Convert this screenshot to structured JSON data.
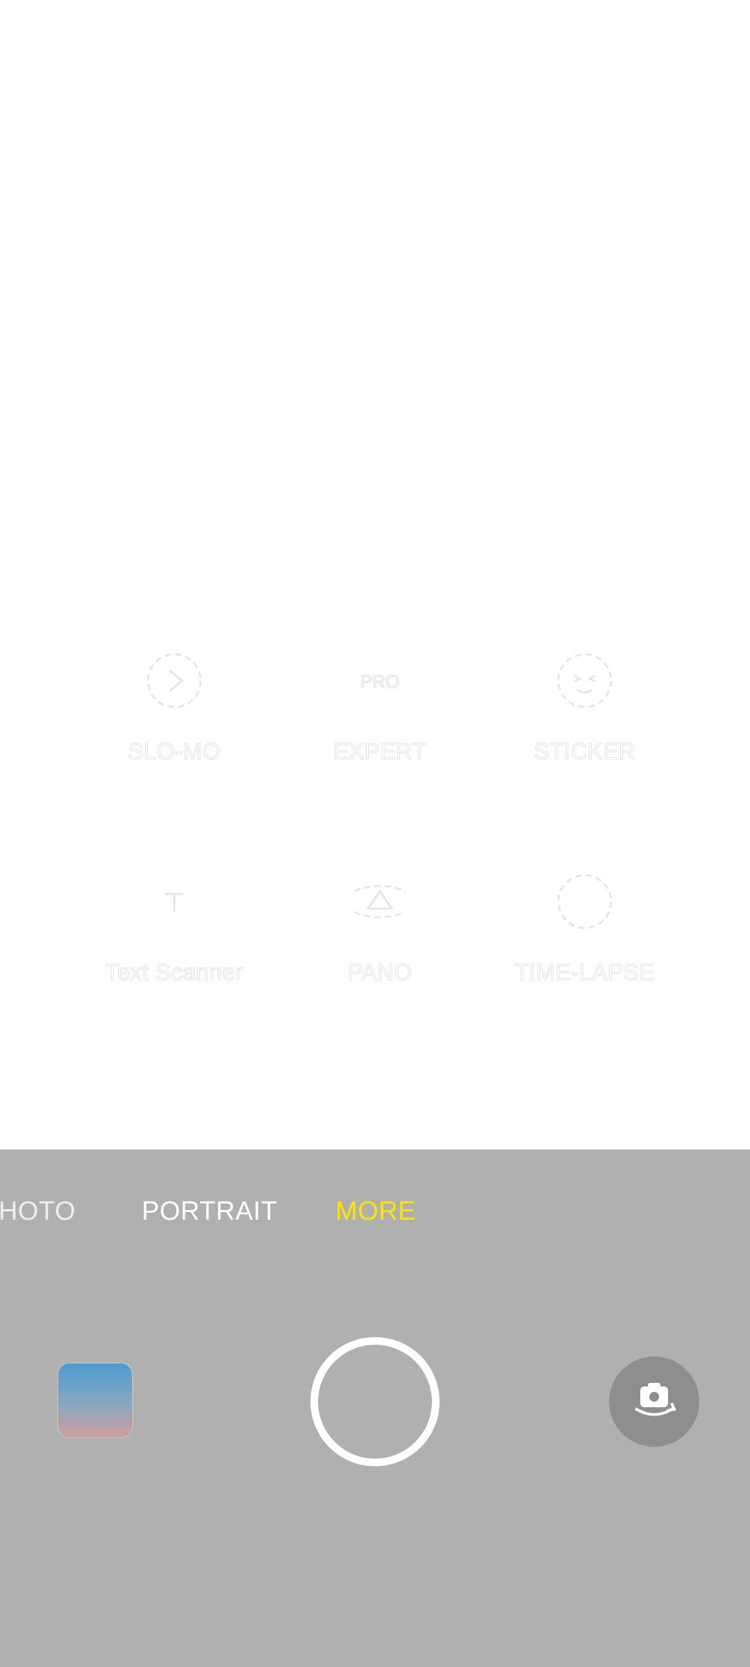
{
  "modes": [
    {
      "id": "slo-mo",
      "label": "SLO-MO",
      "icon": "slow-motion-icon"
    },
    {
      "id": "expert",
      "label": "EXPERT",
      "icon": "expert-icon"
    },
    {
      "id": "sticker",
      "label": "STICKER",
      "icon": "sticker-icon"
    },
    {
      "id": "text-scanner",
      "label": "Text Scanner",
      "icon": "text-scanner-icon"
    },
    {
      "id": "pano",
      "label": "PANO",
      "icon": "pano-icon"
    },
    {
      "id": "time-lapse",
      "label": "TIME-LAPSE",
      "icon": "time-lapse-icon"
    }
  ],
  "tabs": {
    "photo": "PHOTO",
    "portrait": "PORTRAIT",
    "more": "MORE",
    "active": "more"
  },
  "controls": {
    "gallery_icon": "gallery-thumbnail",
    "shutter_icon": "shutter-button",
    "switch_icon": "switch-camera-icon"
  },
  "colors": {
    "accent": "#ffe600",
    "panel": "#b0b0b0"
  }
}
